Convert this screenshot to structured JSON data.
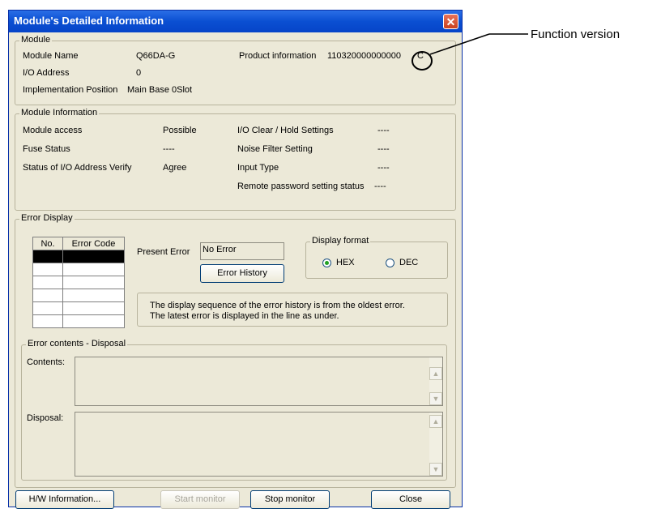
{
  "window": {
    "title": "Module's Detailed Information",
    "close_glyph": "✕"
  },
  "module": {
    "legend": "Module",
    "name_label": "Module Name",
    "name_value": "Q66DA-G",
    "io_label": "I/O Address",
    "io_value": "0",
    "impl_label": "Implementation Position",
    "impl_value": "Main Base  0Slot",
    "product_label": "Product information",
    "product_value": "110320000000000",
    "version_value": "C"
  },
  "module_info": {
    "legend": "Module Information",
    "access_label": "Module access",
    "access_value": "Possible",
    "fuse_label": "Fuse Status",
    "fuse_value": "----",
    "verify_label": "Status of I/O Address Verify",
    "verify_value": "Agree",
    "ioclear_label": "I/O Clear / Hold Settings",
    "ioclear_value": "----",
    "noise_label": "Noise Filter Setting",
    "noise_value": "----",
    "input_label": "Input Type",
    "input_value": "----",
    "remote_label": "Remote password setting status",
    "remote_value": "----"
  },
  "error_display": {
    "legend": "Error Display",
    "col_no": "No.",
    "col_code": "Error Code",
    "present_label": "Present Error",
    "present_value": "No Error",
    "history_button": "Error History",
    "format_legend": "Display format",
    "hex_label": "HEX",
    "dec_label": "DEC",
    "note_line1": "The display sequence of the error history is from the oldest error.",
    "note_line2": "The latest error is displayed in the line as under."
  },
  "contents_disposal": {
    "legend": "Error contents - Disposal",
    "contents_label": "Contents:",
    "disposal_label": "Disposal:"
  },
  "footer": {
    "hw_button": "H/W Information...",
    "start_button": "Start monitor",
    "stop_button": "Stop monitor",
    "close_button": "Close"
  },
  "callout": {
    "label": "Function version"
  },
  "icons": {
    "scroll_up": "▲",
    "scroll_down": "▼"
  }
}
